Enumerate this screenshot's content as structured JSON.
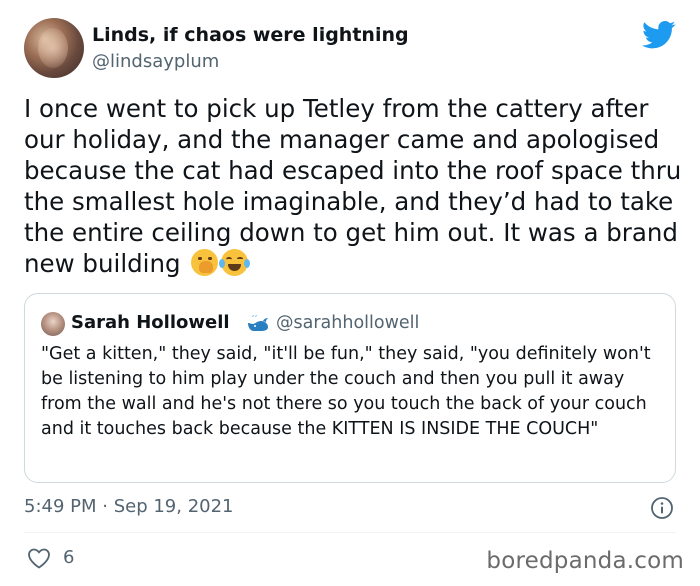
{
  "author": {
    "display_name": "Linds, if chaos were lightning",
    "handle": "@lindsayplum"
  },
  "tweet": {
    "text": "I once went to pick up Tetley from the cattery after our holiday, and the manager came and apologised because the cat had escaped into the roof space thru the smallest hole imaginable, and they’d had to take the entire ceiling down to get him out. It was a brand new building",
    "emojis": [
      "face-with-hand-over-mouth-emoji",
      "face-with-tears-of-joy-emoji"
    ],
    "timestamp": "5:49 PM · Sep 19, 2021",
    "like_count": "6"
  },
  "quoted_tweet": {
    "display_name": "Sarah Hollowell",
    "handle": "@sarahhollowell",
    "badge_icon": "whale-icon",
    "text": "\"Get a kitten,\" they said, \"it'll be fun,\" they said, \"you definitely won't be listening to him play under the couch and then you pull it away from the wall and he's not there so you touch the back of your couch and it touches back because the KITTEN IS INSIDE THE COUCH\""
  },
  "icons": {
    "brand": "twitter-bird-icon",
    "info": "info-icon",
    "like": "heart-icon"
  },
  "colors": {
    "twitter_blue": "#1d9bf0",
    "secondary_text": "#536471",
    "primary_text": "#0f1419",
    "border": "#cfd9de"
  },
  "watermark": "boredpanda.com"
}
